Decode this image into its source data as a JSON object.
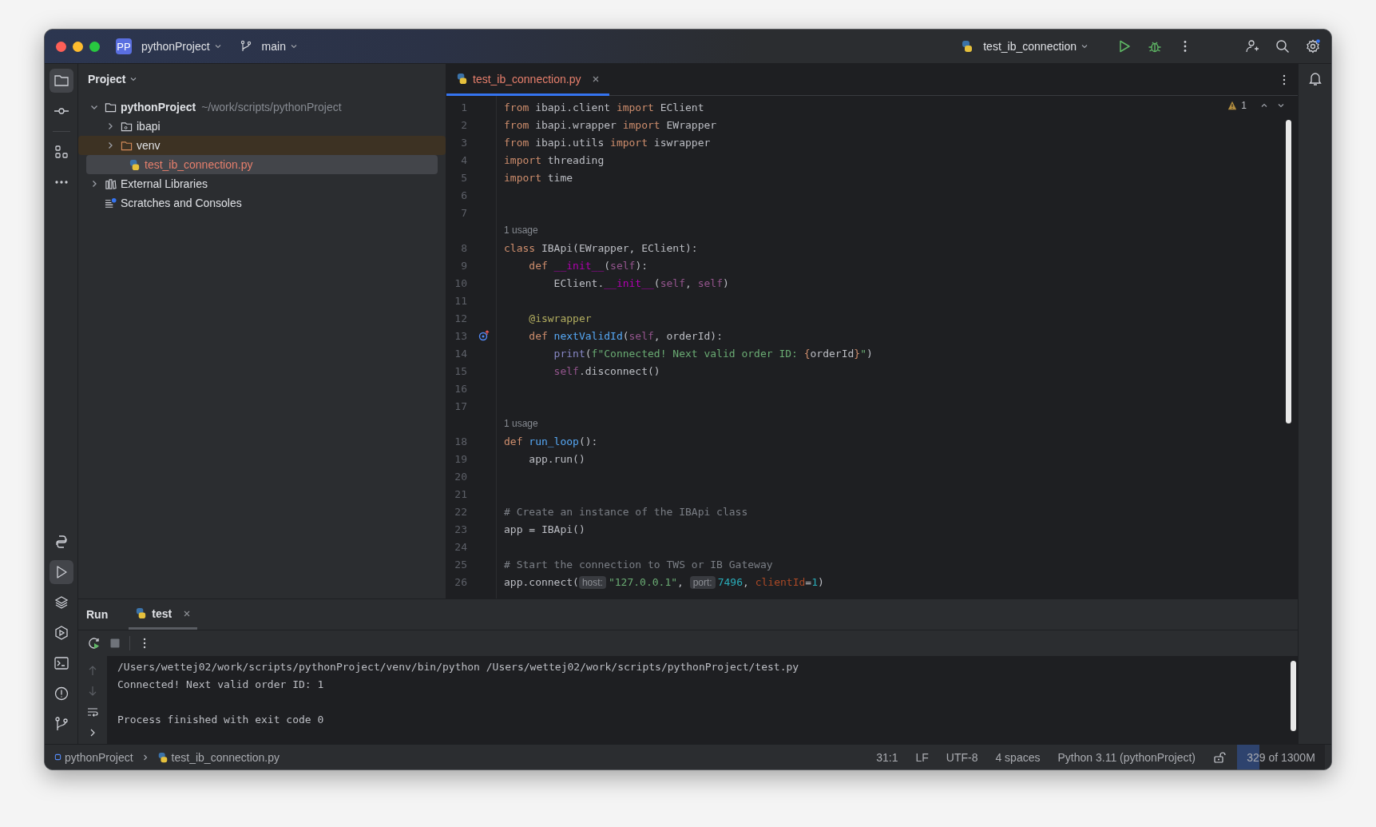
{
  "title_bar": {
    "project_badge": "PP",
    "project": "pythonProject",
    "branch": "main",
    "run_config": "test_ib_connection"
  },
  "left_toolbar": {
    "top": [
      {
        "kind": "folder",
        "selected": true
      },
      {
        "kind": "commit",
        "selected": false
      },
      {
        "kind": "structure",
        "selected": false
      },
      {
        "kind": "more",
        "selected": false
      }
    ],
    "bottom": [
      {
        "kind": "python-console",
        "selected": false
      },
      {
        "kind": "run",
        "selected": true
      },
      {
        "kind": "layers",
        "selected": false
      },
      {
        "kind": "services",
        "selected": false
      },
      {
        "kind": "terminal",
        "selected": false
      },
      {
        "kind": "problems",
        "selected": false
      },
      {
        "kind": "git",
        "selected": false
      }
    ]
  },
  "project": {
    "title": "Project",
    "tree": [
      {
        "kind": "project",
        "label": "pythonProject",
        "path": "~/work/scripts/pythonProject",
        "expanded": true,
        "selected": false,
        "children": [
          {
            "kind": "package",
            "label": "ibapi",
            "expanded": false,
            "selected": false
          },
          {
            "kind": "excluded",
            "label": "venv",
            "expanded": false,
            "selected": false
          },
          {
            "kind": "python",
            "label": "test_ib_connection.py",
            "selected": true
          }
        ]
      },
      {
        "kind": "libraries",
        "label": "External Libraries",
        "expanded": false,
        "selected": false
      },
      {
        "kind": "scratches",
        "label": "Scratches and Consoles",
        "selected": false
      }
    ]
  },
  "editor": {
    "tabs": [
      {
        "label": "test_ib_connection.py",
        "selected": true
      }
    ],
    "warnings": "1",
    "lines": [
      {
        "kind": "code",
        "number": "1",
        "tokens": [
          {
            "kind": "keyword",
            "text": "from"
          },
          {
            "kind": "plain",
            "text": " ibapi.client "
          },
          {
            "kind": "keyword",
            "text": "import"
          },
          {
            "kind": "plain",
            "text": " EClient"
          }
        ]
      },
      {
        "kind": "code",
        "number": "2",
        "tokens": [
          {
            "kind": "keyword",
            "text": "from"
          },
          {
            "kind": "plain",
            "text": " ibapi.wrapper "
          },
          {
            "kind": "keyword",
            "text": "import"
          },
          {
            "kind": "plain",
            "text": " EWrapper"
          }
        ]
      },
      {
        "kind": "code",
        "number": "3",
        "tokens": [
          {
            "kind": "keyword",
            "text": "from"
          },
          {
            "kind": "plain",
            "text": " ibapi.utils "
          },
          {
            "kind": "keyword",
            "text": "import"
          },
          {
            "kind": "plain",
            "text": " iswrapper"
          }
        ]
      },
      {
        "kind": "code",
        "number": "4",
        "tokens": [
          {
            "kind": "keyword",
            "text": "import"
          },
          {
            "kind": "plain",
            "text": " threading"
          }
        ]
      },
      {
        "kind": "code",
        "number": "5",
        "tokens": [
          {
            "kind": "keyword",
            "text": "import"
          },
          {
            "kind": "plain",
            "text": " time"
          }
        ]
      },
      {
        "kind": "code",
        "number": "6"
      },
      {
        "kind": "code",
        "number": "7"
      },
      {
        "kind": "hint",
        "text": "1 usage"
      },
      {
        "kind": "code",
        "number": "8",
        "tokens": [
          {
            "kind": "keyword",
            "text": "class"
          },
          {
            "kind": "plain",
            "text": " IBApi(EWrapper, EClient):"
          }
        ]
      },
      {
        "kind": "code",
        "number": "9",
        "tokens": [
          {
            "kind": "keyword",
            "text": "    def"
          },
          {
            "kind": "magic",
            "text": " __init__"
          },
          {
            "kind": "plain",
            "text": "("
          },
          {
            "kind": "self",
            "text": "self"
          },
          {
            "kind": "plain",
            "text": "):"
          }
        ]
      },
      {
        "kind": "code",
        "number": "10",
        "tokens": [
          {
            "kind": "plain",
            "text": "        EClient."
          },
          {
            "kind": "magic",
            "text": "__init__"
          },
          {
            "kind": "plain",
            "text": "("
          },
          {
            "kind": "self",
            "text": "self"
          },
          {
            "kind": "plain",
            "text": ", "
          },
          {
            "kind": "self",
            "text": "self"
          },
          {
            "kind": "plain",
            "text": ")"
          }
        ]
      },
      {
        "kind": "code",
        "number": "11"
      },
      {
        "kind": "code",
        "number": "12",
        "tokens": [
          {
            "kind": "decorator",
            "text": "    @iswrapper"
          }
        ]
      },
      {
        "kind": "code",
        "number": "13",
        "overrides": true,
        "tokens": [
          {
            "kind": "keyword",
            "text": "    def"
          },
          {
            "kind": "function",
            "text": " nextValidId"
          },
          {
            "kind": "plain",
            "text": "("
          },
          {
            "kind": "self",
            "text": "self"
          },
          {
            "kind": "plain",
            "text": ", orderId):"
          }
        ]
      },
      {
        "kind": "code",
        "number": "14",
        "tokens": [
          {
            "kind": "builtin",
            "text": "        print"
          },
          {
            "kind": "plain",
            "text": "("
          },
          {
            "kind": "string",
            "text": "f\"Connected! Next valid order ID: "
          },
          {
            "kind": "keyword",
            "text": "{"
          },
          {
            "kind": "plain",
            "text": "orderId"
          },
          {
            "kind": "keyword",
            "text": "}"
          },
          {
            "kind": "string",
            "text": "\""
          },
          {
            "kind": "plain",
            "text": ")"
          }
        ]
      },
      {
        "kind": "code",
        "number": "15",
        "tokens": [
          {
            "kind": "self",
            "text": "        self"
          },
          {
            "kind": "plain",
            "text": ".disconnect()"
          }
        ]
      },
      {
        "kind": "code",
        "number": "16"
      },
      {
        "kind": "code",
        "number": "17"
      },
      {
        "kind": "hint",
        "text": "1 usage"
      },
      {
        "kind": "code",
        "number": "18",
        "tokens": [
          {
            "kind": "keyword",
            "text": "def"
          },
          {
            "kind": "function",
            "text": " run_loop"
          },
          {
            "kind": "plain",
            "text": "():"
          }
        ]
      },
      {
        "kind": "code",
        "number": "19",
        "tokens": [
          {
            "kind": "plain",
            "text": "    app.run()"
          }
        ]
      },
      {
        "kind": "code",
        "number": "20"
      },
      {
        "kind": "code",
        "number": "21"
      },
      {
        "kind": "code",
        "number": "22",
        "tokens": [
          {
            "kind": "comment",
            "text": "# Create an instance of the IBApi class"
          }
        ]
      },
      {
        "kind": "code",
        "number": "23",
        "tokens": [
          {
            "kind": "plain",
            "text": "app = IBApi()"
          }
        ]
      },
      {
        "kind": "code",
        "number": "24"
      },
      {
        "kind": "code",
        "number": "25",
        "tokens": [
          {
            "kind": "comment",
            "text": "# Start the connection to TWS or IB Gateway"
          }
        ]
      },
      {
        "kind": "code",
        "number": "26",
        "tokens": [
          {
            "kind": "plain",
            "text": "app.connect("
          },
          {
            "kind": "inlay",
            "text": "host:"
          },
          {
            "kind": "string",
            "text": "\"127.0.0.1\""
          },
          {
            "kind": "plain",
            "text": ", "
          },
          {
            "kind": "inlay",
            "text": "port:"
          },
          {
            "kind": "number",
            "text": "7496"
          },
          {
            "kind": "plain",
            "text": ", "
          },
          {
            "kind": "param",
            "text": "clientId"
          },
          {
            "kind": "plain",
            "text": "="
          },
          {
            "kind": "number",
            "text": "1"
          },
          {
            "kind": "plain",
            "text": ")"
          }
        ]
      }
    ]
  },
  "run": {
    "title": "Run",
    "tabs": [
      {
        "label": "test",
        "selected": true
      }
    ],
    "output": [
      "/Users/wettej02/work/scripts/pythonProject/venv/bin/python /Users/wettej02/work/scripts/pythonProject/test.py",
      "Connected! Next valid order ID: 1"
    ],
    "exit_message": "Process finished with exit code 0"
  },
  "status_bar": {
    "breadcrumbs": [
      "pythonProject",
      "test_ib_connection.py"
    ],
    "items": [
      "31:1",
      "LF",
      "UTF-8",
      "4 spaces",
      "Python 3.11 (pythonProject)"
    ],
    "memory": {
      "text": "329 of 1300M",
      "level": 0.25
    }
  }
}
